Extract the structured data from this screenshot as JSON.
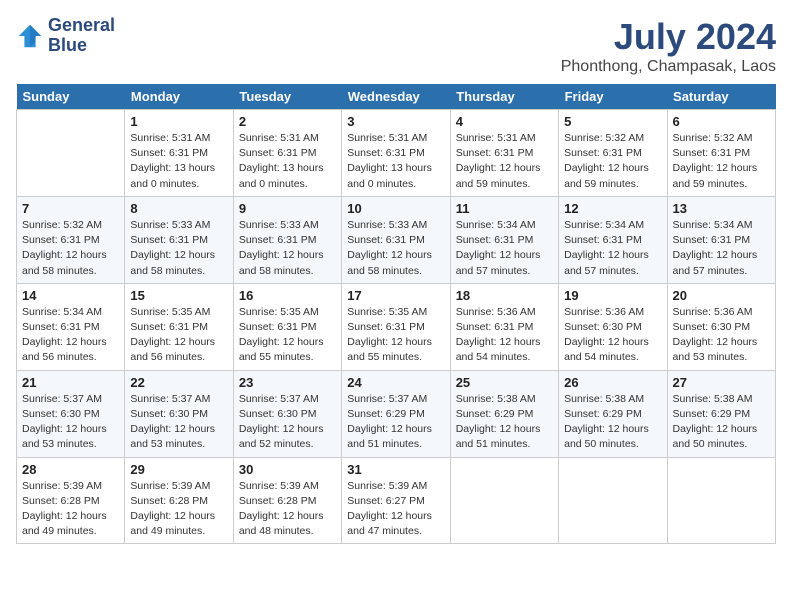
{
  "header": {
    "logo_line1": "General",
    "logo_line2": "Blue",
    "month_year": "July 2024",
    "location": "Phonthong, Champasak, Laos"
  },
  "weekdays": [
    "Sunday",
    "Monday",
    "Tuesday",
    "Wednesday",
    "Thursday",
    "Friday",
    "Saturday"
  ],
  "weeks": [
    [
      {
        "day": "",
        "info": ""
      },
      {
        "day": "1",
        "info": "Sunrise: 5:31 AM\nSunset: 6:31 PM\nDaylight: 13 hours\nand 0 minutes."
      },
      {
        "day": "2",
        "info": "Sunrise: 5:31 AM\nSunset: 6:31 PM\nDaylight: 13 hours\nand 0 minutes."
      },
      {
        "day": "3",
        "info": "Sunrise: 5:31 AM\nSunset: 6:31 PM\nDaylight: 13 hours\nand 0 minutes."
      },
      {
        "day": "4",
        "info": "Sunrise: 5:31 AM\nSunset: 6:31 PM\nDaylight: 12 hours\nand 59 minutes."
      },
      {
        "day": "5",
        "info": "Sunrise: 5:32 AM\nSunset: 6:31 PM\nDaylight: 12 hours\nand 59 minutes."
      },
      {
        "day": "6",
        "info": "Sunrise: 5:32 AM\nSunset: 6:31 PM\nDaylight: 12 hours\nand 59 minutes."
      }
    ],
    [
      {
        "day": "7",
        "info": "Sunrise: 5:32 AM\nSunset: 6:31 PM\nDaylight: 12 hours\nand 58 minutes."
      },
      {
        "day": "8",
        "info": "Sunrise: 5:33 AM\nSunset: 6:31 PM\nDaylight: 12 hours\nand 58 minutes."
      },
      {
        "day": "9",
        "info": "Sunrise: 5:33 AM\nSunset: 6:31 PM\nDaylight: 12 hours\nand 58 minutes."
      },
      {
        "day": "10",
        "info": "Sunrise: 5:33 AM\nSunset: 6:31 PM\nDaylight: 12 hours\nand 58 minutes."
      },
      {
        "day": "11",
        "info": "Sunrise: 5:34 AM\nSunset: 6:31 PM\nDaylight: 12 hours\nand 57 minutes."
      },
      {
        "day": "12",
        "info": "Sunrise: 5:34 AM\nSunset: 6:31 PM\nDaylight: 12 hours\nand 57 minutes."
      },
      {
        "day": "13",
        "info": "Sunrise: 5:34 AM\nSunset: 6:31 PM\nDaylight: 12 hours\nand 57 minutes."
      }
    ],
    [
      {
        "day": "14",
        "info": "Sunrise: 5:34 AM\nSunset: 6:31 PM\nDaylight: 12 hours\nand 56 minutes."
      },
      {
        "day": "15",
        "info": "Sunrise: 5:35 AM\nSunset: 6:31 PM\nDaylight: 12 hours\nand 56 minutes."
      },
      {
        "day": "16",
        "info": "Sunrise: 5:35 AM\nSunset: 6:31 PM\nDaylight: 12 hours\nand 55 minutes."
      },
      {
        "day": "17",
        "info": "Sunrise: 5:35 AM\nSunset: 6:31 PM\nDaylight: 12 hours\nand 55 minutes."
      },
      {
        "day": "18",
        "info": "Sunrise: 5:36 AM\nSunset: 6:31 PM\nDaylight: 12 hours\nand 54 minutes."
      },
      {
        "day": "19",
        "info": "Sunrise: 5:36 AM\nSunset: 6:30 PM\nDaylight: 12 hours\nand 54 minutes."
      },
      {
        "day": "20",
        "info": "Sunrise: 5:36 AM\nSunset: 6:30 PM\nDaylight: 12 hours\nand 53 minutes."
      }
    ],
    [
      {
        "day": "21",
        "info": "Sunrise: 5:37 AM\nSunset: 6:30 PM\nDaylight: 12 hours\nand 53 minutes."
      },
      {
        "day": "22",
        "info": "Sunrise: 5:37 AM\nSunset: 6:30 PM\nDaylight: 12 hours\nand 53 minutes."
      },
      {
        "day": "23",
        "info": "Sunrise: 5:37 AM\nSunset: 6:30 PM\nDaylight: 12 hours\nand 52 minutes."
      },
      {
        "day": "24",
        "info": "Sunrise: 5:37 AM\nSunset: 6:29 PM\nDaylight: 12 hours\nand 51 minutes."
      },
      {
        "day": "25",
        "info": "Sunrise: 5:38 AM\nSunset: 6:29 PM\nDaylight: 12 hours\nand 51 minutes."
      },
      {
        "day": "26",
        "info": "Sunrise: 5:38 AM\nSunset: 6:29 PM\nDaylight: 12 hours\nand 50 minutes."
      },
      {
        "day": "27",
        "info": "Sunrise: 5:38 AM\nSunset: 6:29 PM\nDaylight: 12 hours\nand 50 minutes."
      }
    ],
    [
      {
        "day": "28",
        "info": "Sunrise: 5:39 AM\nSunset: 6:28 PM\nDaylight: 12 hours\nand 49 minutes."
      },
      {
        "day": "29",
        "info": "Sunrise: 5:39 AM\nSunset: 6:28 PM\nDaylight: 12 hours\nand 49 minutes."
      },
      {
        "day": "30",
        "info": "Sunrise: 5:39 AM\nSunset: 6:28 PM\nDaylight: 12 hours\nand 48 minutes."
      },
      {
        "day": "31",
        "info": "Sunrise: 5:39 AM\nSunset: 6:27 PM\nDaylight: 12 hours\nand 47 minutes."
      },
      {
        "day": "",
        "info": ""
      },
      {
        "day": "",
        "info": ""
      },
      {
        "day": "",
        "info": ""
      }
    ]
  ]
}
